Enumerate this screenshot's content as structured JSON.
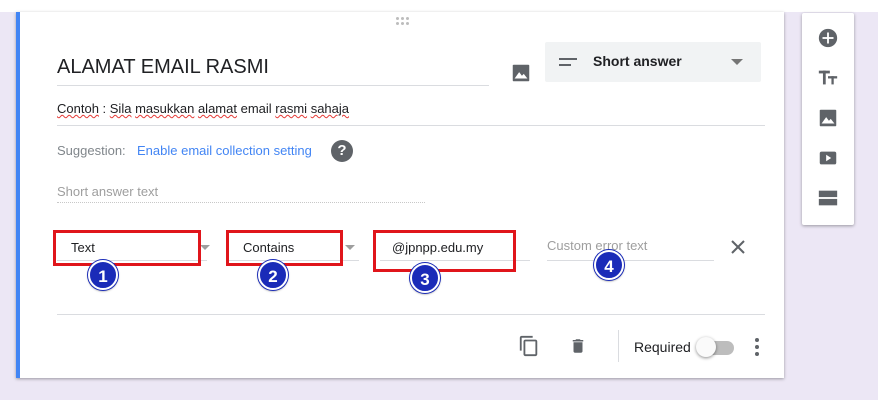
{
  "question": {
    "title": "ALAMAT EMAIL RASMI",
    "description_parts": [
      "Contoh",
      " : ",
      "Sila",
      " ",
      "masukkan",
      " ",
      "alamat",
      " email ",
      "rasmi",
      " ",
      "sahaja"
    ],
    "type_label": "Short answer",
    "answer_placeholder": "Short answer text"
  },
  "suggestion": {
    "label": "Suggestion:",
    "link": "Enable email collection setting",
    "help_glyph": "?"
  },
  "validation": {
    "type_value": "Text",
    "condition_value": "Contains",
    "pattern_value": "@jpnpp.edu.my",
    "error_placeholder": "Custom error text"
  },
  "annotations": [
    "1",
    "2",
    "3",
    "4"
  ],
  "footer": {
    "required_label": "Required",
    "required_on": false
  },
  "icons": {
    "drag": "drag-handle-icon",
    "image": "image-icon",
    "short_answer": "short-answer-icon",
    "help": "help-icon",
    "close": "close-icon",
    "copy": "copy-icon",
    "delete": "delete-icon",
    "more": "more-vert-icon",
    "toolbar": [
      "add-question-icon",
      "add-title-icon",
      "add-image-icon",
      "add-video-icon",
      "add-section-icon"
    ]
  },
  "colors": {
    "accent": "#4285f4",
    "annotation_box": "#e0151b",
    "annotation_badge": "#1a2bb8",
    "background": "#ece7f5"
  }
}
